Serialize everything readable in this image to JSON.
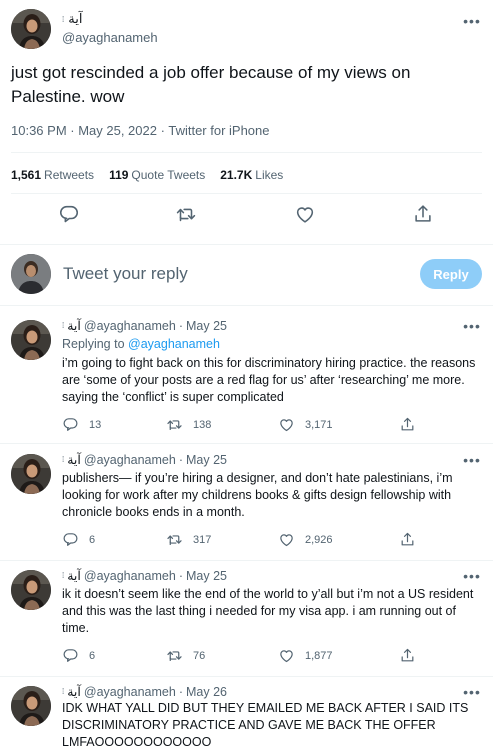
{
  "main_tweet": {
    "display_name": "آية",
    "handle": "@ayaghanameh",
    "text": "just got rescinded a job offer because of my views on Palestine. wow",
    "time": "10:36 PM · May 25, 2022",
    "source": "Twitter for iPhone",
    "retweets_count": "1,561",
    "retweets_label": "Retweets",
    "quotes_count": "119",
    "quotes_label": "Quote Tweets",
    "likes_count": "21.7K",
    "likes_label": "Likes"
  },
  "composer": {
    "placeholder": "Tweet your reply",
    "reply_button": "Reply"
  },
  "replies": [
    {
      "display_name": "آية",
      "handle": "@ayaghanameh",
      "date": "May 25",
      "replying_prefix": "Replying to",
      "replying_to": "@ayaghanameh",
      "text": "i’m going to fight back on this for discriminatory hiring practice. the reasons are ‘some of your posts are a red flag for us’ after ‘researching’ me more. saying the ‘conflict’ is super complicated",
      "replies": "13",
      "retweets": "138",
      "likes": "3,171"
    },
    {
      "display_name": "آية",
      "handle": "@ayaghanameh",
      "date": "May 25",
      "text": "publishers— if you’re hiring a designer, and don’t hate palestinians, i’m looking for work after my childrens books & gifts design fellowship with chronicle books ends in a month.",
      "replies": "6",
      "retweets": "317",
      "likes": "2,926"
    },
    {
      "display_name": "آية",
      "handle": "@ayaghanameh",
      "date": "May 25",
      "text": "ik it doesn’t seem like the end of the world to y’all but i’m not a US resident and this was the last thing i needed for my visa app. i am running out of time.",
      "replies": "6",
      "retweets": "76",
      "likes": "1,877"
    },
    {
      "display_name": "آية",
      "handle": "@ayaghanameh",
      "date": "May 26",
      "text": "IDK WHAT YALL DID BUT THEY EMAILED ME BACK AFTER I SAID ITS DISCRIMINATORY PRACTICE AND GAVE ME BACK THE OFFER LMFAOOOOOOOOOOOO"
    }
  ],
  "separator": "·",
  "more_glyph": "•••",
  "colors": {
    "accent": "#1d9bf0",
    "reply_button_disabled": "#8ecdf8",
    "secondary_text": "#536471",
    "divider": "#eff3f4"
  }
}
